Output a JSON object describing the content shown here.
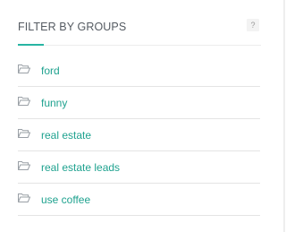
{
  "filter_panel": {
    "title": "FILTER BY GROUPS",
    "help_label": "?",
    "groups": [
      {
        "label": "ford",
        "icon": "folder-open-icon"
      },
      {
        "label": "funny",
        "icon": "folder-open-icon"
      },
      {
        "label": "real estate",
        "icon": "folder-open-icon"
      },
      {
        "label": "real estate leads",
        "icon": "folder-open-icon"
      },
      {
        "label": "use coffee",
        "icon": "folder-open-icon"
      }
    ]
  },
  "colors": {
    "accent": "#27b5a3",
    "link": "#1fa28f",
    "heading": "#555b62",
    "divider": "#e4e4e4",
    "icon": "#9aa0a6"
  }
}
